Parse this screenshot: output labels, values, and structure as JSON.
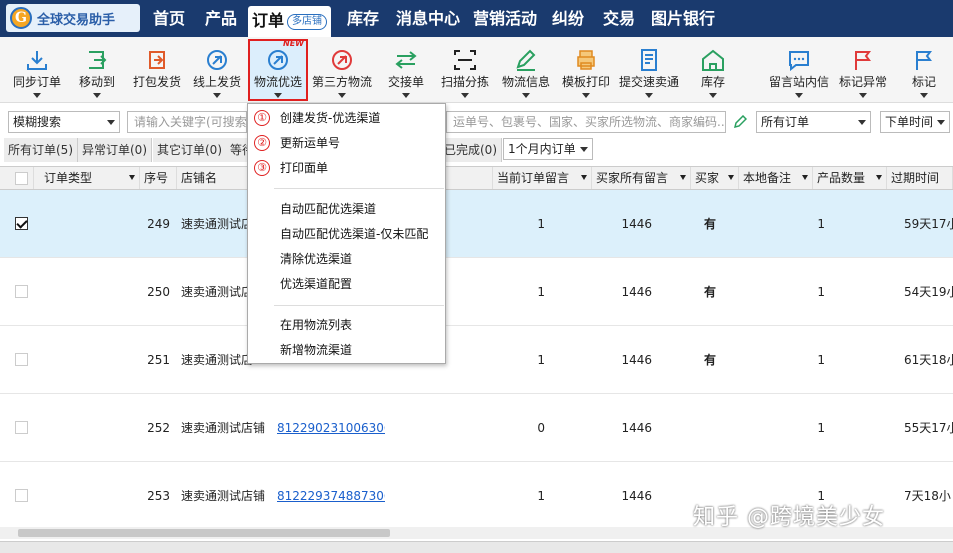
{
  "app": {
    "logo_text": "全球交易助手",
    "logo_mark": "G"
  },
  "nav": {
    "items": [
      "首页",
      "产品",
      "订单",
      "库存",
      "消息中心",
      "营销活动",
      "纠纷",
      "交易",
      "图片银行"
    ],
    "order_badge": "多店铺"
  },
  "toolbar": {
    "buttons": [
      "同步订单",
      "移动到",
      "打包发货",
      "线上发货",
      "物流优选",
      "第三方物流",
      "交接单",
      "扫描分拣",
      "物流信息",
      "模板打印",
      "提交速卖通",
      "库存",
      "留言站内信",
      "标记异常",
      "标记"
    ],
    "new_tag": "NEW"
  },
  "filter": {
    "search_mode": "模糊搜索",
    "keyword_placeholder": "请输入关键字(可搜索",
    "keyword_hint": "运单号、包裹号、国家、买家所选物流、商家编码...",
    "order_scope": "所有订单",
    "sort": "下单时间"
  },
  "status_tabs": [
    "所有订单(5)",
    "异常订单(0)",
    "其它订单(0)",
    "等待",
    "已完成(0)",
    "1个月内订单"
  ],
  "table": {
    "headers": [
      "订单类型",
      "序号",
      "店铺名",
      "当前订单留言",
      "买家所有留言",
      "买家",
      "本地备注",
      "产品数量",
      "过期时间"
    ],
    "rows": [
      {
        "no": "249",
        "shop": "速卖通测试店",
        "order_id": "",
        "cur_msg": "1",
        "all_msg": "1446",
        "buyer": "有",
        "qty": "1",
        "expire": "59天17小",
        "checked": true
      },
      {
        "no": "250",
        "shop": "速卖通测试店",
        "order_id": "",
        "cur_msg": "1",
        "all_msg": "1446",
        "buyer": "有",
        "qty": "1",
        "expire": "54天19小",
        "checked": false
      },
      {
        "no": "251",
        "shop": "速卖通测试店",
        "order_id": "",
        "cur_msg": "1",
        "all_msg": "1446",
        "buyer": "有",
        "qty": "1",
        "expire": "61天18小",
        "checked": false
      },
      {
        "no": "252",
        "shop": "速卖通测试店铺",
        "order_id": "812290231006306",
        "cur_msg": "0",
        "all_msg": "1446",
        "buyer": "",
        "qty": "1",
        "expire": "55天17小",
        "checked": false
      },
      {
        "no": "253",
        "shop": "速卖通测试店铺",
        "order_id": "812229374887306",
        "cur_msg": "1",
        "all_msg": "1446",
        "buyer": "",
        "qty": "1",
        "expire": "7天18小",
        "checked": false
      }
    ]
  },
  "dropdown": {
    "numbered": [
      {
        "num": "①",
        "label": "创建发货-优选渠道"
      },
      {
        "num": "②",
        "label": "更新运单号"
      },
      {
        "num": "③",
        "label": "打印面单"
      }
    ],
    "group2": [
      "自动匹配优选渠道",
      "自动匹配优选渠道-仅未匹配",
      "清除优选渠道",
      "优选渠道配置"
    ],
    "group3": [
      "在用物流列表",
      "新增物流渠道"
    ]
  },
  "watermark": "知乎 @跨境美少女",
  "colors": {
    "nav_bg": "#1a3a6e",
    "highlight": "#e02020",
    "selected_row": "#dcf0fb",
    "link": "#1a5fcc"
  }
}
